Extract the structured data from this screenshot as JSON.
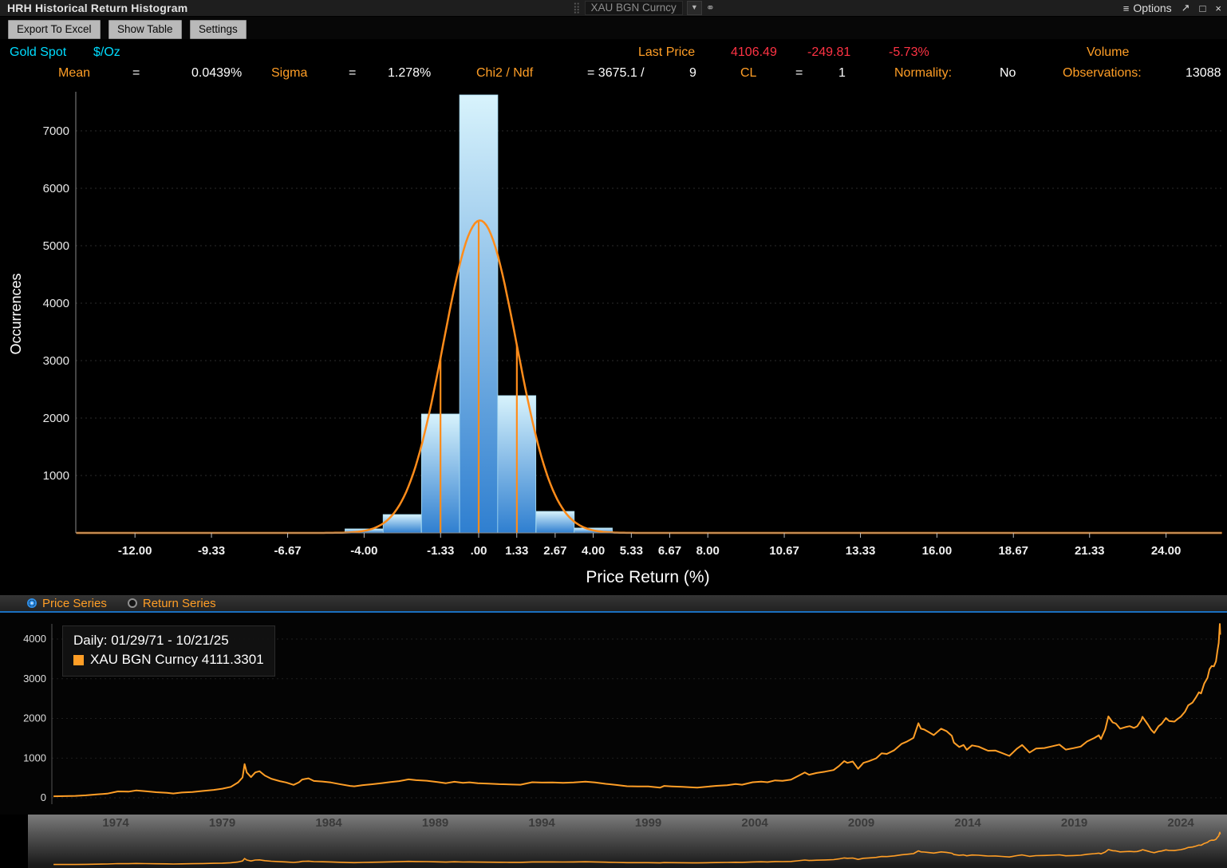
{
  "titlebar": {
    "title": "HRH Historical Return Histogram",
    "security_input": "XAU BGN Curncy",
    "dropdown_caret": "▼",
    "options_label": "Options"
  },
  "toolbar": {
    "buttons": [
      "Export To Excel",
      "Show Table",
      "Settings"
    ]
  },
  "stats": {
    "security_name": "Gold Spot",
    "unit": "$/Oz",
    "last_price_label": "Last Price",
    "last_price": "4106.49",
    "change": "-249.81",
    "change_pct": "-5.73%",
    "volume_label": "Volume",
    "mean_label": "Mean",
    "eq": "=",
    "mean_value": "0.0439%",
    "sigma_label": "Sigma",
    "sigma_value": "1.278%",
    "chi2_label": "Chi2 / Ndf",
    "chi2_value": "= 3675.1 /",
    "ndf_value": "9",
    "cl_label": "CL",
    "cl_value": "1",
    "normality_label": "Normality:",
    "normality_value": "No",
    "observations_label": "Observations:",
    "observations_value": "13088"
  },
  "series_toggle": {
    "options": [
      {
        "label": "Price Series",
        "selected": true
      },
      {
        "label": "Return Series",
        "selected": false
      }
    ]
  },
  "price_legend": {
    "range": "Daily: 01/29/71 - 10/21/25",
    "series_label": "XAU BGN Curncy 4111.3301"
  },
  "colors": {
    "accent_orange": "#ff9e26",
    "curve_orange": "#ff8c1a",
    "bar_blue_bottom": "#2f7fd0",
    "bar_blue_top": "#d8f3fc",
    "negative_red": "#ff3344",
    "cyan": "#00dcff",
    "radio_blue": "#2f8fe8",
    "nav_year_text": "#3a3a3a"
  },
  "chart_data": [
    {
      "type": "bar",
      "name": "historical-return-histogram",
      "xlabel": "Price Return (%)",
      "ylabel": "Occurrences",
      "bin_width": 1.333,
      "categories": [
        -4.0,
        -2.67,
        -1.33,
        0.0,
        1.33,
        2.67,
        4.0
      ],
      "values": [
        70,
        320,
        2070,
        7625,
        2390,
        375,
        85
      ],
      "center_bar_clipped": true,
      "x_ticks": [
        -12.0,
        -9.33,
        -6.67,
        -4.0,
        -1.33,
        0.0,
        1.33,
        2.67,
        4.0,
        5.33,
        6.67,
        8.0,
        10.67,
        13.33,
        16.0,
        18.67,
        21.33,
        24.0
      ],
      "x_tick_labels": [
        "-12.00",
        "-9.33",
        "-6.67",
        "-4.00",
        "-1.33",
        ".00",
        "1.33",
        "2.67",
        "4.00",
        "5.33",
        "6.67",
        "8.00",
        "10.67",
        "13.33",
        "16.00",
        "18.67",
        "21.33",
        "24.00"
      ],
      "y_ticks": [
        1000,
        2000,
        3000,
        4000,
        5000,
        6000,
        7000
      ],
      "xlim": [
        -14.05,
        25.95
      ],
      "ylim": [
        0,
        7625
      ],
      "grid": "dotted-horizontal",
      "fit": {
        "type": "gaussian",
        "mean": 0.0439,
        "sigma": 1.278,
        "peak": 5440
      },
      "fit_vlines": [
        -1.333,
        0.0,
        1.333
      ]
    },
    {
      "type": "line",
      "name": "price-series-daily",
      "title": "XAU BGN Curncy daily price 01/29/71 - 10/21/25",
      "y_ticks": [
        0,
        1000,
        2000,
        3000,
        4000
      ],
      "x_ticks": [
        1974,
        1979,
        1984,
        1989,
        1994,
        1999,
        2004,
        2009,
        2014,
        2019,
        2024
      ],
      "xlim": [
        1971.0,
        2025.95
      ],
      "ylim": [
        -150,
        4660
      ],
      "grid": "dotted-horizontal",
      "last_value": 4111.3301,
      "points": [
        [
          1971.08,
          38
        ],
        [
          1971.6,
          42
        ],
        [
          1972.1,
          48
        ],
        [
          1972.6,
          62
        ],
        [
          1973.1,
          85
        ],
        [
          1973.6,
          105
        ],
        [
          1974.1,
          160
        ],
        [
          1974.6,
          155
        ],
        [
          1974.95,
          185
        ],
        [
          1975.4,
          165
        ],
        [
          1975.9,
          140
        ],
        [
          1976.4,
          125
        ],
        [
          1976.7,
          108
        ],
        [
          1977.1,
          132
        ],
        [
          1977.6,
          146
        ],
        [
          1978.1,
          172
        ],
        [
          1978.6,
          200
        ],
        [
          1979.0,
          230
        ],
        [
          1979.4,
          275
        ],
        [
          1979.75,
          390
        ],
        [
          1979.95,
          512
        ],
        [
          1980.05,
          850
        ],
        [
          1980.15,
          640
        ],
        [
          1980.35,
          520
        ],
        [
          1980.55,
          640
        ],
        [
          1980.75,
          670
        ],
        [
          1981.0,
          560
        ],
        [
          1981.3,
          480
        ],
        [
          1981.7,
          420
        ],
        [
          1982.0,
          385
        ],
        [
          1982.35,
          325
        ],
        [
          1982.6,
          390
        ],
        [
          1982.75,
          460
        ],
        [
          1983.05,
          490
        ],
        [
          1983.3,
          425
        ],
        [
          1983.7,
          410
        ],
        [
          1984.1,
          385
        ],
        [
          1984.5,
          345
        ],
        [
          1985.0,
          300
        ],
        [
          1985.2,
          290
        ],
        [
          1985.6,
          320
        ],
        [
          1986.0,
          340
        ],
        [
          1986.5,
          370
        ],
        [
          1986.9,
          395
        ],
        [
          1987.3,
          420
        ],
        [
          1987.75,
          465
        ],
        [
          1988.1,
          445
        ],
        [
          1988.6,
          430
        ],
        [
          1989.1,
          395
        ],
        [
          1989.5,
          368
        ],
        [
          1989.9,
          405
        ],
        [
          1990.3,
          375
        ],
        [
          1990.6,
          390
        ],
        [
          1991.0,
          368
        ],
        [
          1991.5,
          358
        ],
        [
          1992.0,
          344
        ],
        [
          1992.5,
          338
        ],
        [
          1993.0,
          330
        ],
        [
          1993.55,
          392
        ],
        [
          1994.0,
          384
        ],
        [
          1994.5,
          386
        ],
        [
          1995.0,
          378
        ],
        [
          1995.5,
          386
        ],
        [
          1996.05,
          408
        ],
        [
          1996.5,
          385
        ],
        [
          1997.0,
          352
        ],
        [
          1997.5,
          324
        ],
        [
          1998.0,
          292
        ],
        [
          1998.5,
          288
        ],
        [
          1999.0,
          286
        ],
        [
          1999.55,
          256
        ],
        [
          1999.75,
          300
        ],
        [
          2000.1,
          288
        ],
        [
          2000.6,
          276
        ],
        [
          2001.1,
          262
        ],
        [
          2001.3,
          258
        ],
        [
          2001.7,
          278
        ],
        [
          2002.2,
          302
        ],
        [
          2002.7,
          318
        ],
        [
          2003.1,
          348
        ],
        [
          2003.4,
          330
        ],
        [
          2003.9,
          392
        ],
        [
          2004.3,
          408
        ],
        [
          2004.6,
          392
        ],
        [
          2004.95,
          438
        ],
        [
          2005.3,
          428
        ],
        [
          2005.7,
          456
        ],
        [
          2006.0,
          540
        ],
        [
          2006.35,
          640
        ],
        [
          2006.55,
          580
        ],
        [
          2006.9,
          625
        ],
        [
          2007.3,
          660
        ],
        [
          2007.7,
          700
        ],
        [
          2007.95,
          800
        ],
        [
          2008.2,
          925
        ],
        [
          2008.35,
          880
        ],
        [
          2008.6,
          915
        ],
        [
          2008.85,
          730
        ],
        [
          2009.1,
          880
        ],
        [
          2009.35,
          920
        ],
        [
          2009.7,
          995
        ],
        [
          2009.95,
          1120
        ],
        [
          2010.2,
          1105
        ],
        [
          2010.55,
          1200
        ],
        [
          2010.9,
          1360
        ],
        [
          2011.15,
          1420
        ],
        [
          2011.45,
          1510
        ],
        [
          2011.68,
          1880
        ],
        [
          2011.8,
          1740
        ],
        [
          2011.95,
          1720
        ],
        [
          2012.15,
          1660
        ],
        [
          2012.4,
          1580
        ],
        [
          2012.75,
          1740
        ],
        [
          2013.0,
          1680
        ],
        [
          2013.25,
          1560
        ],
        [
          2013.35,
          1390
        ],
        [
          2013.6,
          1280
        ],
        [
          2013.8,
          1330
        ],
        [
          2013.95,
          1210
        ],
        [
          2014.2,
          1320
        ],
        [
          2014.5,
          1290
        ],
        [
          2014.8,
          1220
        ],
        [
          2014.95,
          1185
        ],
        [
          2015.3,
          1190
        ],
        [
          2015.6,
          1130
        ],
        [
          2015.95,
          1055
        ],
        [
          2016.3,
          1235
        ],
        [
          2016.55,
          1330
        ],
        [
          2016.9,
          1140
        ],
        [
          2017.2,
          1240
        ],
        [
          2017.6,
          1255
        ],
        [
          2017.9,
          1290
        ],
        [
          2018.3,
          1340
        ],
        [
          2018.6,
          1215
        ],
        [
          2018.95,
          1250
        ],
        [
          2019.3,
          1290
        ],
        [
          2019.6,
          1420
        ],
        [
          2019.95,
          1510
        ],
        [
          2020.15,
          1575
        ],
        [
          2020.25,
          1480
        ],
        [
          2020.45,
          1720
        ],
        [
          2020.6,
          2050
        ],
        [
          2020.8,
          1900
        ],
        [
          2020.95,
          1870
        ],
        [
          2021.15,
          1740
        ],
        [
          2021.4,
          1780
        ],
        [
          2021.6,
          1805
        ],
        [
          2021.8,
          1760
        ],
        [
          2021.95,
          1800
        ],
        [
          2022.15,
          1960
        ],
        [
          2022.2,
          2040
        ],
        [
          2022.45,
          1850
        ],
        [
          2022.6,
          1720
        ],
        [
          2022.75,
          1635
        ],
        [
          2022.95,
          1800
        ],
        [
          2023.1,
          1865
        ],
        [
          2023.3,
          2010
        ],
        [
          2023.45,
          1935
        ],
        [
          2023.7,
          1920
        ],
        [
          2023.85,
          1985
        ],
        [
          2024.0,
          2045
        ],
        [
          2024.2,
          2170
        ],
        [
          2024.35,
          2330
        ],
        [
          2024.55,
          2400
        ],
        [
          2024.7,
          2520
        ],
        [
          2024.85,
          2660
        ],
        [
          2024.95,
          2630
        ],
        [
          2025.1,
          2880
        ],
        [
          2025.25,
          3020
        ],
        [
          2025.35,
          3240
        ],
        [
          2025.45,
          3320
        ],
        [
          2025.55,
          3310
        ],
        [
          2025.65,
          3440
        ],
        [
          2025.72,
          3700
        ],
        [
          2025.78,
          3900
        ],
        [
          2025.83,
          4380
        ],
        [
          2025.85,
          4111
        ]
      ]
    },
    {
      "type": "line",
      "name": "range-selector-overview",
      "role": "mini overview of price series (navigator band)",
      "x_ticks": [
        1974,
        1979,
        1984,
        1989,
        1994,
        1999,
        2004,
        2009,
        2014,
        2019,
        2024
      ],
      "uses_points_of": "price-series-daily"
    }
  ]
}
